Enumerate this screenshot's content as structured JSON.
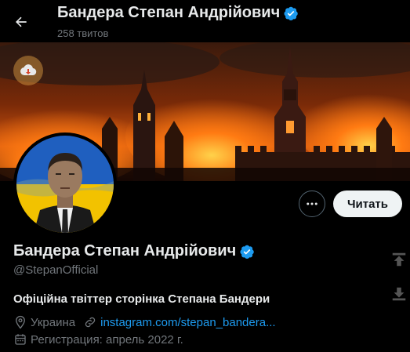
{
  "header": {
    "name": "Бандера Степан Андрійович",
    "tweet_count": "258 твитов"
  },
  "profile": {
    "name": "Бандера Степан Андрійович",
    "handle": "@StepanOfficial",
    "bio": "Офіційна твіттер сторінка Степана Бандери",
    "location": "Украина",
    "link": "instagram.com/stepan_bandera...",
    "joined": "Регистрация: апрель 2022 г."
  },
  "actions": {
    "follow_label": "Читать",
    "more_icon": "more-horizontal-icon"
  },
  "icons": {
    "back": "arrow-left-icon",
    "verified": "verified-badge-icon",
    "location": "map-pin-icon",
    "link": "link-icon",
    "calendar": "calendar-icon",
    "cloud": "cloud-download-icon",
    "scroll_up": "arrow-up-icon",
    "scroll_down": "arrow-down-icon"
  },
  "colors": {
    "background": "#000000",
    "text_primary": "#e7e9ea",
    "text_secondary": "#71767b",
    "link": "#1d9bf0",
    "verified": "#1d9bf0",
    "follow_bg": "#eff3f4",
    "flag_blue": "#1f5fbf",
    "flag_yellow": "#f2c200"
  }
}
